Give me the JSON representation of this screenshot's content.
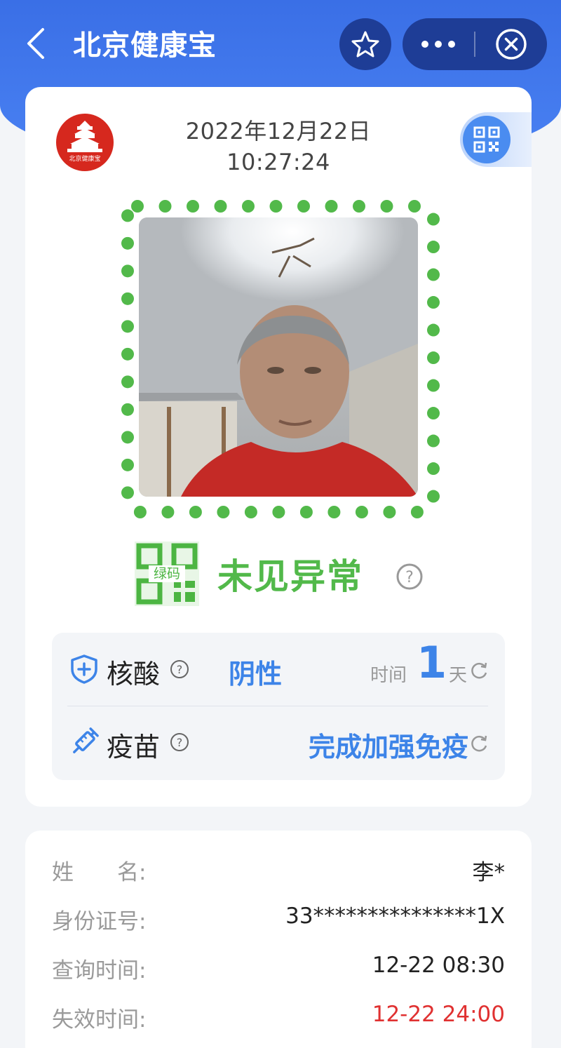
{
  "topbar": {
    "title": "北京健康宝"
  },
  "card": {
    "logo_text": "北京健康宝",
    "date": "2022年12月22日",
    "time": "10:27:24"
  },
  "status": {
    "code_label": "绿码",
    "text": "未见异常",
    "color": "#52b94a"
  },
  "pcr": {
    "label": "核酸",
    "result": "阴性",
    "time_label": "时间",
    "days": "1",
    "unit": "天"
  },
  "vaccine": {
    "label": "疫苗",
    "status": "完成加强免疫"
  },
  "personal": {
    "rows": [
      {
        "label": "姓　　名:",
        "value": "李*"
      },
      {
        "label": "身份证号:",
        "value": "33***************1X"
      },
      {
        "label": "查询时间:",
        "value": "12-22 08:30"
      },
      {
        "label": "失效时间:",
        "value": "12-22 24:00"
      }
    ]
  },
  "colors": {
    "brand_blue": "#3a6fe6",
    "capsule": "#1e3d96",
    "accent_blue": "#3d84e8",
    "green": "#52b94a",
    "expire_red": "#e03131"
  }
}
